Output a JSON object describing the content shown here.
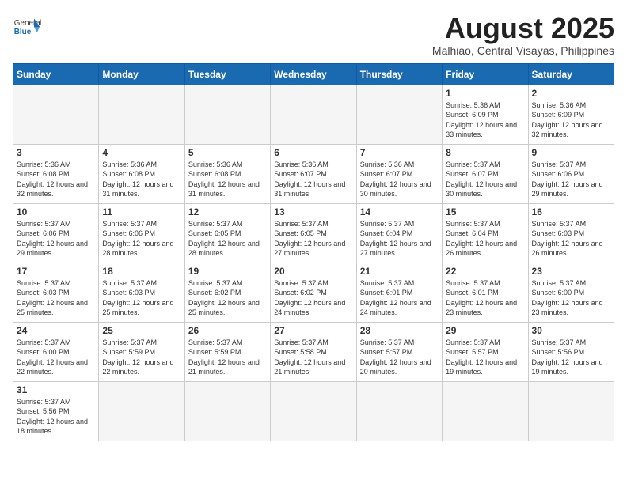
{
  "header": {
    "logo_general": "General",
    "logo_blue": "Blue",
    "title": "August 2025",
    "location": "Malhiao, Central Visayas, Philippines"
  },
  "days_of_week": [
    "Sunday",
    "Monday",
    "Tuesday",
    "Wednesday",
    "Thursday",
    "Friday",
    "Saturday"
  ],
  "weeks": [
    [
      {
        "num": "",
        "detail": "",
        "empty": true
      },
      {
        "num": "",
        "detail": "",
        "empty": true
      },
      {
        "num": "",
        "detail": "",
        "empty": true
      },
      {
        "num": "",
        "detail": "",
        "empty": true
      },
      {
        "num": "",
        "detail": "",
        "empty": true
      },
      {
        "num": "1",
        "detail": "Sunrise: 5:36 AM\nSunset: 6:09 PM\nDaylight: 12 hours\nand 33 minutes.",
        "empty": false
      },
      {
        "num": "2",
        "detail": "Sunrise: 5:36 AM\nSunset: 6:09 PM\nDaylight: 12 hours\nand 32 minutes.",
        "empty": false
      }
    ],
    [
      {
        "num": "3",
        "detail": "Sunrise: 5:36 AM\nSunset: 6:08 PM\nDaylight: 12 hours\nand 32 minutes.",
        "empty": false
      },
      {
        "num": "4",
        "detail": "Sunrise: 5:36 AM\nSunset: 6:08 PM\nDaylight: 12 hours\nand 31 minutes.",
        "empty": false
      },
      {
        "num": "5",
        "detail": "Sunrise: 5:36 AM\nSunset: 6:08 PM\nDaylight: 12 hours\nand 31 minutes.",
        "empty": false
      },
      {
        "num": "6",
        "detail": "Sunrise: 5:36 AM\nSunset: 6:07 PM\nDaylight: 12 hours\nand 31 minutes.",
        "empty": false
      },
      {
        "num": "7",
        "detail": "Sunrise: 5:36 AM\nSunset: 6:07 PM\nDaylight: 12 hours\nand 30 minutes.",
        "empty": false
      },
      {
        "num": "8",
        "detail": "Sunrise: 5:37 AM\nSunset: 6:07 PM\nDaylight: 12 hours\nand 30 minutes.",
        "empty": false
      },
      {
        "num": "9",
        "detail": "Sunrise: 5:37 AM\nSunset: 6:06 PM\nDaylight: 12 hours\nand 29 minutes.",
        "empty": false
      }
    ],
    [
      {
        "num": "10",
        "detail": "Sunrise: 5:37 AM\nSunset: 6:06 PM\nDaylight: 12 hours\nand 29 minutes.",
        "empty": false
      },
      {
        "num": "11",
        "detail": "Sunrise: 5:37 AM\nSunset: 6:06 PM\nDaylight: 12 hours\nand 28 minutes.",
        "empty": false
      },
      {
        "num": "12",
        "detail": "Sunrise: 5:37 AM\nSunset: 6:05 PM\nDaylight: 12 hours\nand 28 minutes.",
        "empty": false
      },
      {
        "num": "13",
        "detail": "Sunrise: 5:37 AM\nSunset: 6:05 PM\nDaylight: 12 hours\nand 27 minutes.",
        "empty": false
      },
      {
        "num": "14",
        "detail": "Sunrise: 5:37 AM\nSunset: 6:04 PM\nDaylight: 12 hours\nand 27 minutes.",
        "empty": false
      },
      {
        "num": "15",
        "detail": "Sunrise: 5:37 AM\nSunset: 6:04 PM\nDaylight: 12 hours\nand 26 minutes.",
        "empty": false
      },
      {
        "num": "16",
        "detail": "Sunrise: 5:37 AM\nSunset: 6:03 PM\nDaylight: 12 hours\nand 26 minutes.",
        "empty": false
      }
    ],
    [
      {
        "num": "17",
        "detail": "Sunrise: 5:37 AM\nSunset: 6:03 PM\nDaylight: 12 hours\nand 25 minutes.",
        "empty": false
      },
      {
        "num": "18",
        "detail": "Sunrise: 5:37 AM\nSunset: 6:03 PM\nDaylight: 12 hours\nand 25 minutes.",
        "empty": false
      },
      {
        "num": "19",
        "detail": "Sunrise: 5:37 AM\nSunset: 6:02 PM\nDaylight: 12 hours\nand 25 minutes.",
        "empty": false
      },
      {
        "num": "20",
        "detail": "Sunrise: 5:37 AM\nSunset: 6:02 PM\nDaylight: 12 hours\nand 24 minutes.",
        "empty": false
      },
      {
        "num": "21",
        "detail": "Sunrise: 5:37 AM\nSunset: 6:01 PM\nDaylight: 12 hours\nand 24 minutes.",
        "empty": false
      },
      {
        "num": "22",
        "detail": "Sunrise: 5:37 AM\nSunset: 6:01 PM\nDaylight: 12 hours\nand 23 minutes.",
        "empty": false
      },
      {
        "num": "23",
        "detail": "Sunrise: 5:37 AM\nSunset: 6:00 PM\nDaylight: 12 hours\nand 23 minutes.",
        "empty": false
      }
    ],
    [
      {
        "num": "24",
        "detail": "Sunrise: 5:37 AM\nSunset: 6:00 PM\nDaylight: 12 hours\nand 22 minutes.",
        "empty": false
      },
      {
        "num": "25",
        "detail": "Sunrise: 5:37 AM\nSunset: 5:59 PM\nDaylight: 12 hours\nand 22 minutes.",
        "empty": false
      },
      {
        "num": "26",
        "detail": "Sunrise: 5:37 AM\nSunset: 5:59 PM\nDaylight: 12 hours\nand 21 minutes.",
        "empty": false
      },
      {
        "num": "27",
        "detail": "Sunrise: 5:37 AM\nSunset: 5:58 PM\nDaylight: 12 hours\nand 21 minutes.",
        "empty": false
      },
      {
        "num": "28",
        "detail": "Sunrise: 5:37 AM\nSunset: 5:57 PM\nDaylight: 12 hours\nand 20 minutes.",
        "empty": false
      },
      {
        "num": "29",
        "detail": "Sunrise: 5:37 AM\nSunset: 5:57 PM\nDaylight: 12 hours\nand 19 minutes.",
        "empty": false
      },
      {
        "num": "30",
        "detail": "Sunrise: 5:37 AM\nSunset: 5:56 PM\nDaylight: 12 hours\nand 19 minutes.",
        "empty": false
      }
    ],
    [
      {
        "num": "31",
        "detail": "Sunrise: 5:37 AM\nSunset: 5:56 PM\nDaylight: 12 hours\nand 18 minutes.",
        "empty": false
      },
      {
        "num": "",
        "detail": "",
        "empty": true
      },
      {
        "num": "",
        "detail": "",
        "empty": true
      },
      {
        "num": "",
        "detail": "",
        "empty": true
      },
      {
        "num": "",
        "detail": "",
        "empty": true
      },
      {
        "num": "",
        "detail": "",
        "empty": true
      },
      {
        "num": "",
        "detail": "",
        "empty": true
      }
    ]
  ]
}
